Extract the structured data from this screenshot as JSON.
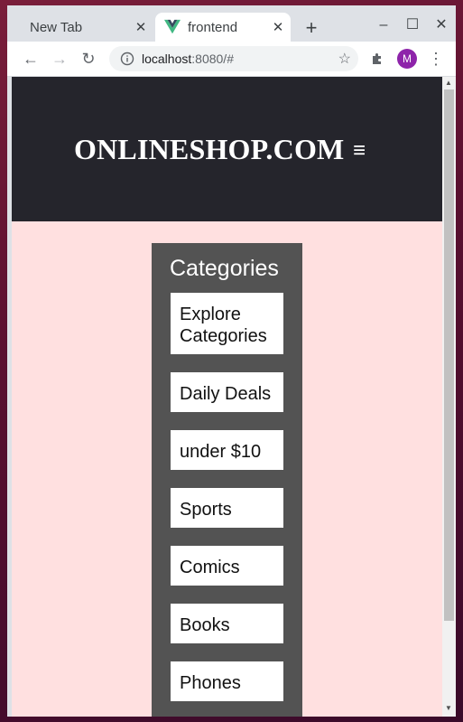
{
  "tabs": [
    {
      "title": "New Tab",
      "active": false
    },
    {
      "title": "frontend",
      "active": true
    }
  ],
  "address": {
    "host": "localhost",
    "rest": ":8080/#"
  },
  "profile_initial": "M",
  "header": {
    "brand": "ONLINESHOP.COM",
    "menu_glyph": "≡"
  },
  "categories": {
    "title": "Categories",
    "items": [
      "Explore Categories",
      "Daily Deals",
      "under $10",
      "Sports",
      "Comics",
      "Books",
      "Phones"
    ]
  },
  "colors": {
    "header_bg": "#25252c",
    "page_bg": "#ffe0e0",
    "panel_bg": "#535353",
    "vue_green": "#41b883"
  }
}
